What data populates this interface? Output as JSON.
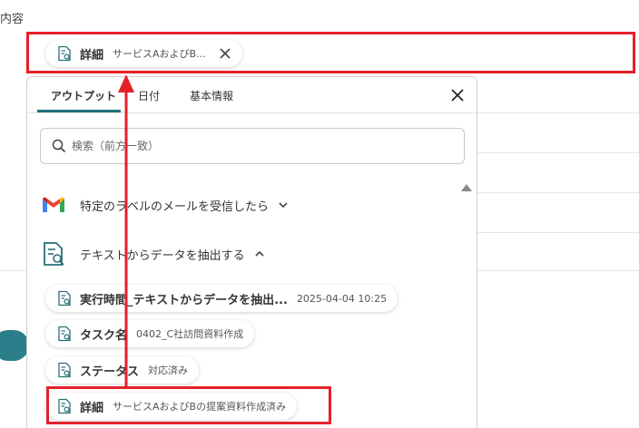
{
  "field": {
    "label": "内容",
    "chip": {
      "title": "詳細",
      "value": "サービスAおよびB..."
    }
  },
  "panel": {
    "tabs": [
      {
        "label": "アウトプット",
        "active": true
      },
      {
        "label": "日付",
        "active": false
      },
      {
        "label": "基本情報",
        "active": false
      }
    ],
    "search_placeholder": "検索（前方一致）",
    "sections": [
      {
        "label": "特定のラベルのメールを受信したら",
        "icon": "gmail-icon",
        "expanded": false
      },
      {
        "label": "テキストからデータを抽出する",
        "icon": "document-search-icon",
        "expanded": true
      }
    ],
    "items": [
      {
        "title": "実行時間_テキストからデータを抽出...",
        "value": "2025-04-04 10:25"
      },
      {
        "title": "タスク名",
        "value": "0402_C社訪問資料作成"
      },
      {
        "title": "ステータス",
        "value": "対応済み"
      },
      {
        "title": "詳細",
        "value": "サービスAおよびBの提案資料作成済み"
      }
    ]
  },
  "colors": {
    "highlight": "#e5202a",
    "accent": "#1f6f7a"
  }
}
